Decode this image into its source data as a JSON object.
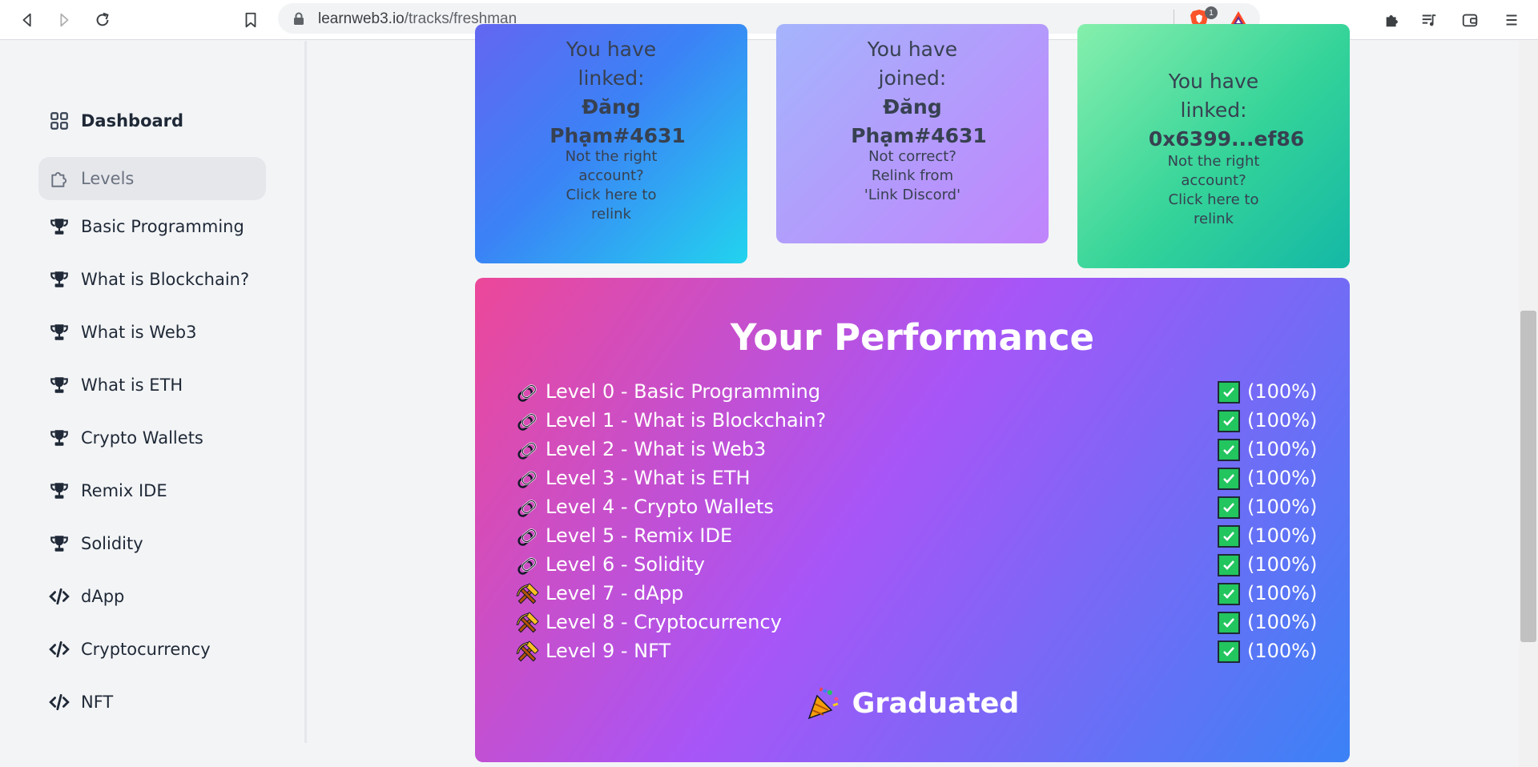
{
  "browser": {
    "url_host": "learnweb3.io",
    "url_path": "/tracks/freshman",
    "brave_badge": "1"
  },
  "sidebar": {
    "items": [
      {
        "label": "Dashboard",
        "icon": "grid-icon"
      },
      {
        "label": "Levels",
        "icon": "puzzle-icon"
      },
      {
        "label": "Basic Programming",
        "icon": "trophy-icon"
      },
      {
        "label": "What is Blockchain?",
        "icon": "trophy-icon"
      },
      {
        "label": "What is Web3",
        "icon": "trophy-icon"
      },
      {
        "label": "What is ETH",
        "icon": "trophy-icon"
      },
      {
        "label": "Crypto Wallets",
        "icon": "trophy-icon"
      },
      {
        "label": "Remix IDE",
        "icon": "trophy-icon"
      },
      {
        "label": "Solidity",
        "icon": "trophy-icon"
      },
      {
        "label": "dApp",
        "icon": "code-icon"
      },
      {
        "label": "Cryptocurrency",
        "icon": "code-icon"
      },
      {
        "label": "NFT",
        "icon": "code-icon"
      }
    ]
  },
  "cards": {
    "discord_linked": {
      "line1": "You have",
      "line2": "linked:",
      "name1": "Đăng",
      "name2": "Phạm#4631",
      "hint1": "Not the right",
      "hint2": "account?",
      "hint3": "Click here to",
      "hint4": "relink"
    },
    "discord_joined": {
      "line1": "You have",
      "line2": "joined:",
      "name1": "Đăng",
      "name2": "Phạm#4631",
      "hint1": "Not correct?",
      "hint2": "Relink from",
      "hint3": "'Link Discord'"
    },
    "wallet_linked": {
      "line1": "You have",
      "line2": "linked:",
      "address": "0x6399...ef86",
      "hint1": "Not the right",
      "hint2": "account?",
      "hint3": "Click here to",
      "hint4": "relink"
    }
  },
  "performance": {
    "title": "Your Performance",
    "levels": [
      {
        "label": "Level 0 - Basic Programming",
        "percent": "(100%)",
        "icon": "paperclip-icon"
      },
      {
        "label": "Level 1 - What is Blockchain?",
        "percent": "(100%)",
        "icon": "paperclip-icon"
      },
      {
        "label": "Level 2 - What is Web3",
        "percent": "(100%)",
        "icon": "paperclip-icon"
      },
      {
        "label": "Level 3 - What is ETH",
        "percent": "(100%)",
        "icon": "paperclip-icon"
      },
      {
        "label": "Level 4 - Crypto Wallets",
        "percent": "(100%)",
        "icon": "paperclip-icon"
      },
      {
        "label": "Level 5 - Remix IDE",
        "percent": "(100%)",
        "icon": "paperclip-icon"
      },
      {
        "label": "Level 6 - Solidity",
        "percent": "(100%)",
        "icon": "paperclip-icon"
      },
      {
        "label": "Level 7 - dApp",
        "percent": "(100%)",
        "icon": "hammer-pick-icon"
      },
      {
        "label": "Level 8 - Cryptocurrency",
        "percent": "(100%)",
        "icon": "hammer-pick-icon"
      },
      {
        "label": "Level 9 - NFT",
        "percent": "(100%)",
        "icon": "hammer-pick-icon"
      }
    ],
    "status": "Graduated",
    "status_icon": "party-popper-icon"
  }
}
